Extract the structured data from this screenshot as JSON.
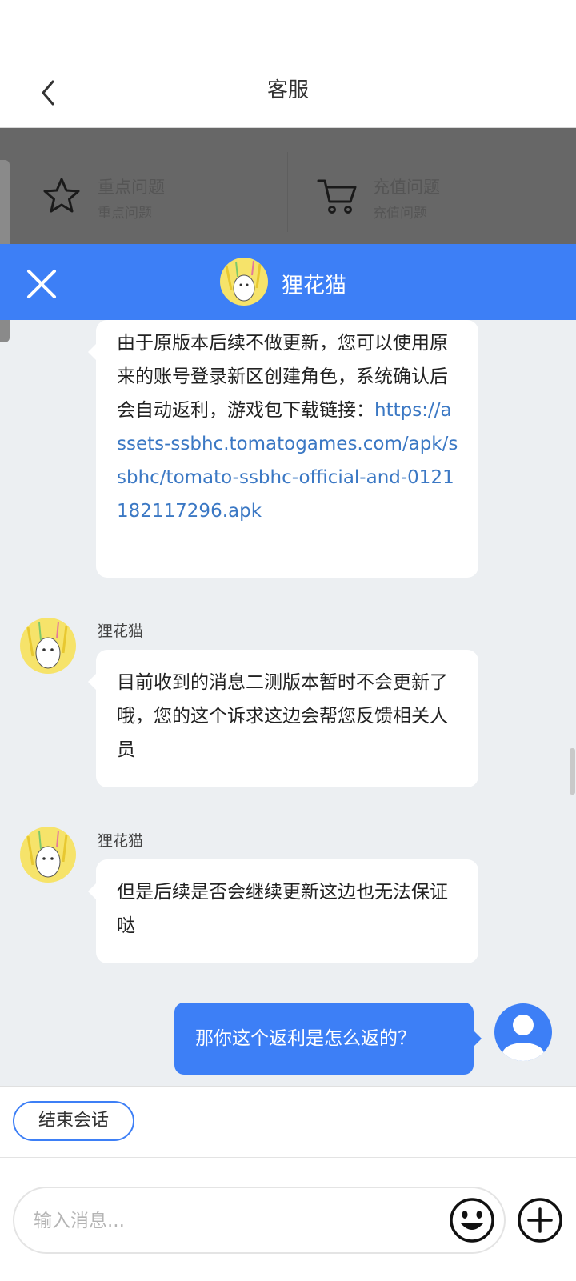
{
  "header": {
    "title": "客服"
  },
  "faq": {
    "items": [
      {
        "title": "重点问题",
        "subtitle": "重点问题",
        "icon": "star-icon"
      },
      {
        "title": "充值问题",
        "subtitle": "充值问题",
        "icon": "cart-icon"
      }
    ]
  },
  "agent_bar": {
    "name": "狸花猫"
  },
  "messages": [
    {
      "text": "由于原版本后续不做更新，您可以使用原来的账号登录新区创建角色，系统确认后会自动返利，游戏包下载链接：",
      "link": "https://assets-ssbhc.tomatogames.com/apk/ssbhc/tomato-ssbhc-official-and-0121182117296.apk"
    },
    {
      "sender": "狸花猫",
      "text": "目前收到的消息二测版本暂时不会更新了哦，您的这个诉求这边会帮您反馈相关人员"
    },
    {
      "sender": "狸花猫",
      "text": "但是后续是否会继续更新这边也无法保证哒"
    }
  ],
  "my_message": {
    "text": "那你这个返利是怎么返的？"
  },
  "bottom": {
    "end_button": "结束会话",
    "input_placeholder": "输入消息...",
    "input_value": ""
  },
  "colors": {
    "accent": "#3d7ff6",
    "overlay": "#676767",
    "background": "#eceff2"
  }
}
